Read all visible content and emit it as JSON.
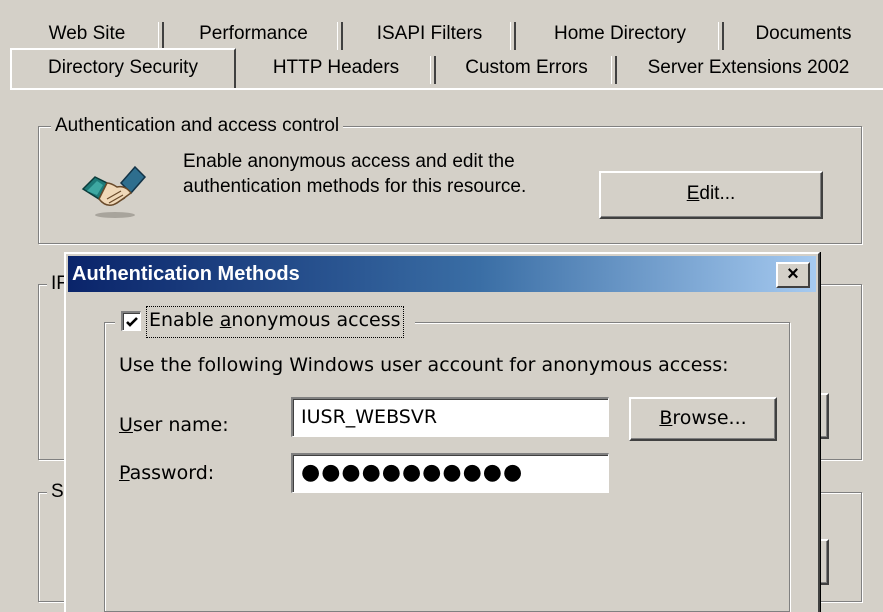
{
  "properties": {
    "tabs_back": [
      "Web Site",
      "Performance",
      "ISAPI Filters",
      "Home Directory",
      "Documents"
    ],
    "tabs_front": [
      "Directory Security",
      "HTTP Headers",
      "Custom Errors",
      "Server Extensions 2002"
    ],
    "selected_tab": "Directory Security",
    "auth_group": {
      "legend": "Authentication and access control",
      "description_line1": "Enable anonymous access and edit the",
      "description_line2": "authentication methods for this resource.",
      "edit_button_prefix": "",
      "edit_button_mnemonic": "E",
      "edit_button_rest": "dit...",
      "icon": "handshake-icon"
    },
    "ip_group": {
      "legend_partial": "IF"
    },
    "secure_group": {
      "legend_partial": "S"
    }
  },
  "dialog": {
    "title": "Authentication Methods",
    "close_label": "×",
    "anonymous_checkbox": {
      "checked": true,
      "label_prefix": "Enable ",
      "label_mnemonic": "a",
      "label_rest": "nonymous access"
    },
    "instruction": "Use the following Windows user account for anonymous access:",
    "username_label_mnemonic": "U",
    "username_label_rest": "ser name:",
    "username_value": "IUSR_WEBSVR",
    "password_label_mnemonic": "P",
    "password_label_rest": "assword:",
    "password_value": "●●●●●●●●●●●",
    "browse_mnemonic": "B",
    "browse_rest": "rowse..."
  },
  "colors": {
    "face": "#d4d0c8",
    "title_start": "#0a246a",
    "title_end": "#a6caf0"
  }
}
